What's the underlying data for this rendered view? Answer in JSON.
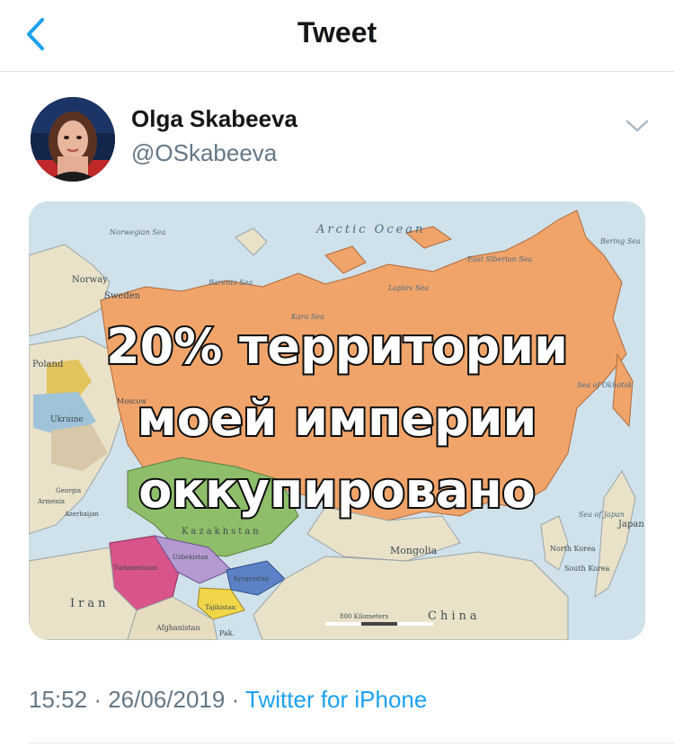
{
  "header": {
    "title": "Tweet"
  },
  "tweet": {
    "author_name": "Olga Skabeeva",
    "author_handle": "@OSkabeeva",
    "time": "15:52",
    "separator": "·",
    "date": "26/06/2019",
    "source": "Twitter for iPhone"
  },
  "media": {
    "caption_lines": [
      "20% территории",
      "моей империи",
      "оккупировано"
    ],
    "map_labels": {
      "arctic": "Arctic Ocean",
      "norwegian": "Norwegian Sea",
      "barents": "Barents Sea",
      "kara": "Kara Sea",
      "laptev": "Laptev Sea",
      "east_siberian": "East Siberian Sea",
      "bering": "Bering Sea",
      "okhotsk": "Sea of Okhotsk",
      "japan_sea": "Sea of Japan",
      "japan": "Japan",
      "norway": "Norway",
      "sweden": "Sweden",
      "poland": "Poland",
      "ukraine": "Ukraine",
      "moscow": "Moscow",
      "mongolia": "Mongolia",
      "china": "China",
      "iran": "Iran",
      "afghanistan": "Afghanistan",
      "pak": "Pak.",
      "north_korea": "North Korea",
      "south_korea": "South Korea",
      "kazakhstan": "Kazakhstan",
      "uzbekistan": "Uzbekistan",
      "turkmenistan": "Turkmenistan",
      "kyrgyzstan": "Kyrgyzstan",
      "tajikistan": "Tajikistan",
      "georgia": "Georgia",
      "armenia": "Armenia",
      "azerbaijan": "Azerbaijan",
      "scale": "800 Kilometers"
    },
    "colors": {
      "water": "#cfe1ea",
      "land": "#e9e2c9",
      "russia": "#f0a46a",
      "kazakhstan": "#8fbe6a",
      "turkmenistan": "#d8548a",
      "uzbekistan": "#b49ad0",
      "kyrgyzstan": "#5b82c6",
      "tajikistan": "#f2d64a"
    }
  },
  "icons": {
    "back": "chevron-left-icon",
    "more": "chevron-down-icon"
  }
}
